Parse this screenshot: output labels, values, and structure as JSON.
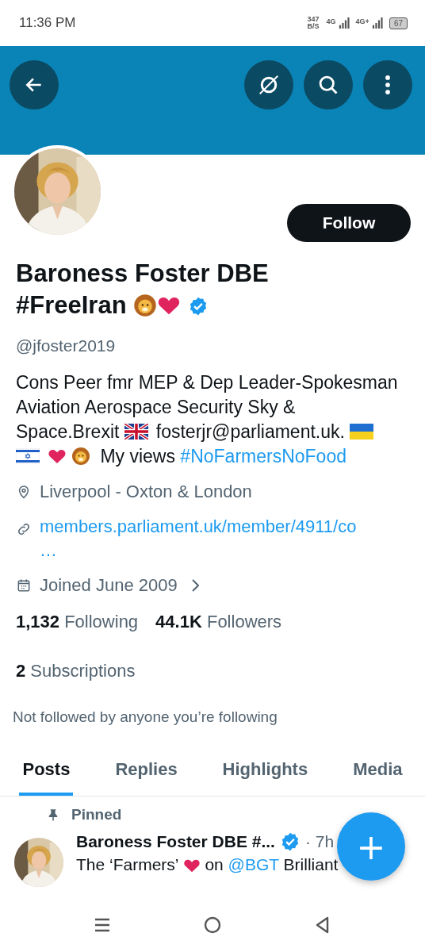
{
  "status_bar": {
    "time": "11:36 PM",
    "speed": "347",
    "speed_unit": "B/S",
    "network_1": "4G",
    "network_2": "4G+",
    "battery": "67"
  },
  "header": {
    "buttons": [
      {
        "kind": "back"
      },
      {
        "kind": "translate"
      },
      {
        "kind": "search"
      },
      {
        "kind": "more"
      }
    ]
  },
  "profile": {
    "follow_button": "Follow",
    "name": "Baroness Foster DBE #FreeIran",
    "name_emoji": [
      {
        "kind": "lion"
      },
      {
        "kind": "heart"
      }
    ],
    "verified": true,
    "handle": "@jfoster2019",
    "bio": [
      {
        "kind": "text",
        "text": "Cons Peer fmr MEP & Dep Leader-Spokesman Aviation Aerospace Security Sky & Space.Brexit "
      },
      {
        "kind": "flag_uk"
      },
      {
        "kind": "text",
        "text": "fosterjr@parliament.uk. "
      },
      {
        "kind": "flag_ua"
      },
      {
        "kind": "flag_il"
      },
      {
        "kind": "heart"
      },
      {
        "kind": "lion"
      },
      {
        "kind": "text",
        "text": " My views "
      },
      {
        "kind": "link",
        "text": "#NoFarmersNoFood"
      }
    ],
    "location": "Liverpool - Oxton & London",
    "website": "members.parliament.uk/member/4911/co…",
    "joined": "Joined June 2009",
    "following_count": "1,132",
    "following_label": "Following",
    "followers_count": "44.1K",
    "followers_label": "Followers",
    "subscriptions_count": "2",
    "subscriptions_label": "Subscriptions",
    "followed_by": "Not followed by anyone you’re following"
  },
  "tabs": [
    {
      "label": "Posts",
      "selected": true
    },
    {
      "label": "Replies",
      "selected": false
    },
    {
      "label": "Highlights",
      "selected": false
    },
    {
      "label": "Media",
      "selected": false
    }
  ],
  "pinned_post": {
    "pinned_label": "Pinned",
    "author": "Baroness Foster DBE #...",
    "verified": true,
    "time": "· 7h",
    "text": [
      {
        "kind": "text",
        "text": "The ‘Farmers’ "
      },
      {
        "kind": "heart"
      },
      {
        "kind": "text",
        "text": " on "
      },
      {
        "kind": "link",
        "text": "@BGT"
      },
      {
        "kind": "text",
        "text": " Brilliant"
      }
    ]
  },
  "fab": {
    "label": "+"
  }
}
